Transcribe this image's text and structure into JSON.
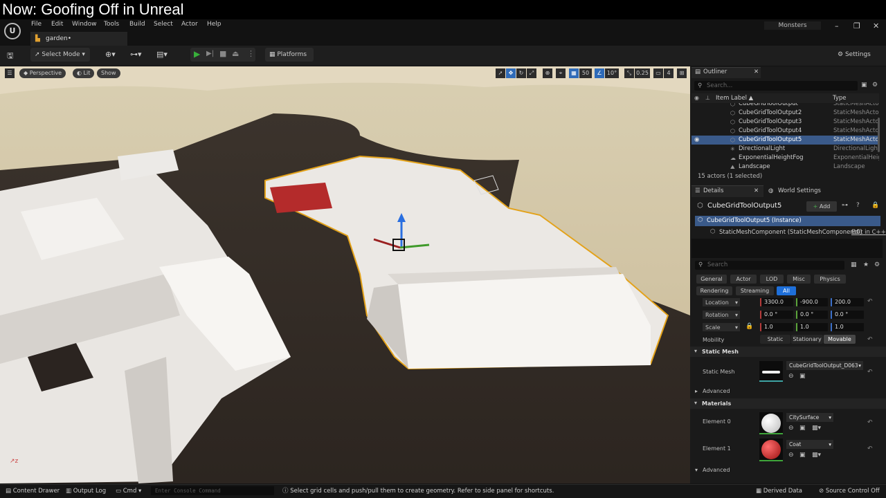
{
  "banner": "Now: Goofing Off in Unreal",
  "menu": [
    "File",
    "Edit",
    "Window",
    "Tools",
    "Build",
    "Select",
    "Actor",
    "Help"
  ],
  "project_tab": "garden•",
  "project_name": "Monsters",
  "window_controls": {
    "minimize": "–",
    "restore": "❐",
    "close": "✕"
  },
  "toolbar": {
    "select_mode": "Select Mode",
    "platforms": "Platforms",
    "settings": "Settings"
  },
  "viewport": {
    "perspective": "Perspective",
    "lit": "Lit",
    "show": "Show",
    "grid_snap": "50",
    "rot_snap": "10°",
    "scale_snap": "0.25",
    "cam_speed": "4"
  },
  "outliner": {
    "tab": "Outliner",
    "search_placeholder": "Search...",
    "col_label": "Item Label ▲",
    "col_type": "Type",
    "rows": [
      {
        "name": "CubeGridToolOutput",
        "type": "StaticMeshActor"
      },
      {
        "name": "CubeGridToolOutput2",
        "type": "StaticMeshActor"
      },
      {
        "name": "CubeGridToolOutput3",
        "type": "StaticMeshActor"
      },
      {
        "name": "CubeGridToolOutput4",
        "type": "StaticMeshActor"
      },
      {
        "name": "CubeGridToolOutput5",
        "type": "StaticMeshActor",
        "selected": true
      },
      {
        "name": "DirectionalLight",
        "type": "DirectionalLight"
      },
      {
        "name": "ExponentialHeightFog",
        "type": "ExponentialHeightFog"
      },
      {
        "name": "Landscape",
        "type": "Landscape"
      }
    ],
    "footer": "15 actors (1 selected)"
  },
  "details": {
    "tab": "Details",
    "world_settings": "World Settings",
    "actor_name": "CubeGridToolOutput5",
    "add_label": "Add",
    "instance": "CubeGridToolOutput5 (Instance)",
    "component": "StaticMeshComponent (StaticMeshComponent0)",
    "edit_cpp": "Edit in C++",
    "search_placeholder": "Search",
    "filters_row1": [
      "General",
      "Actor",
      "LOD",
      "Misc",
      "Physics"
    ],
    "filters_row2": [
      "Rendering",
      "Streaming",
      "All"
    ],
    "location": {
      "label": "Location",
      "x": "3300.0",
      "y": "-900.0",
      "z": "200.0"
    },
    "rotation": {
      "label": "Rotation",
      "x": "0.0 °",
      "y": "0.0 °",
      "z": "0.0 °"
    },
    "scale": {
      "label": "Scale",
      "x": "1.0",
      "y": "1.0",
      "z": "1.0"
    },
    "mobility": {
      "label": "Mobility",
      "options": [
        "Static",
        "Stationary",
        "Movable"
      ],
      "selected": "Movable"
    },
    "static_mesh_section": "Static Mesh",
    "static_mesh_label": "Static Mesh",
    "static_mesh_value": "CubeGridToolOutput_D063",
    "advanced": "Advanced",
    "materials_section": "Materials",
    "element0": {
      "label": "Element 0",
      "value": "CitySurface"
    },
    "element1": {
      "label": "Element 1",
      "value": "Coat"
    },
    "advanced2": "Advanced"
  },
  "status": {
    "content_drawer": "Content Drawer",
    "output_log": "Output Log",
    "cmd": "Cmd",
    "console_placeholder": "Enter Console Command",
    "hint": "Select grid cells and push/pull them to create geometry. Refer to side panel for shortcuts.",
    "derived_data": "Derived Data",
    "source_control": "Source Control Off"
  },
  "colors": {
    "accent": "#1e6fd9",
    "selection": "#3a5a8a",
    "play": "#38b03a",
    "outline": "#e3a21a"
  }
}
